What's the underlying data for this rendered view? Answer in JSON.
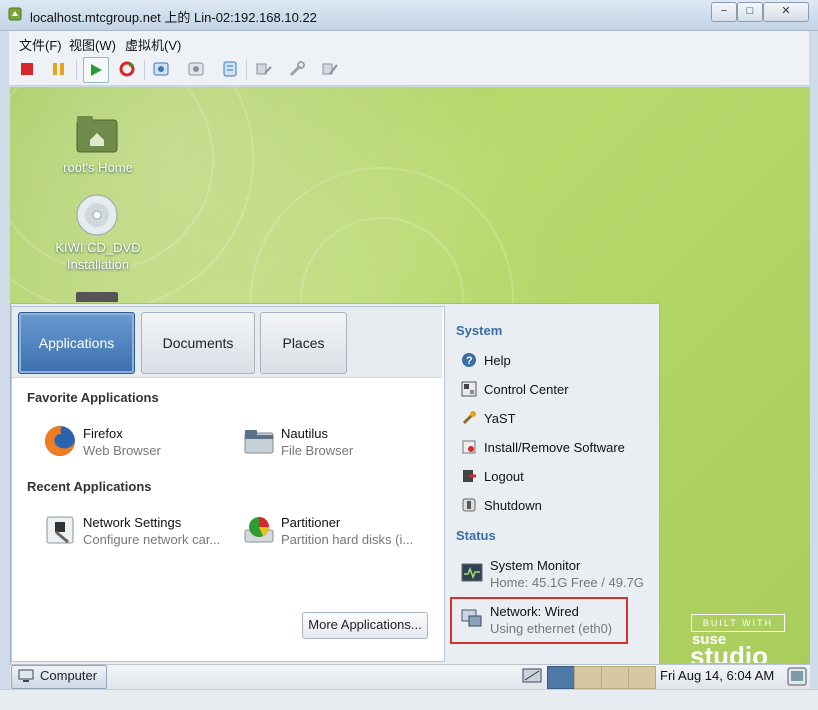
{
  "window": {
    "title": "localhost.mtcgroup.net 上的 Lin-02:192.168.10.22",
    "controls": {
      "minimize": "−",
      "maximize": "□",
      "close": "✕"
    }
  },
  "menubar": {
    "items": [
      "文件(F)",
      "视图(W)",
      "虚拟机(V)"
    ]
  },
  "desktop": {
    "icons": [
      {
        "label": "root's Home"
      },
      {
        "label_line1": "KIWI CD_DVD",
        "label_line2": "Installation"
      }
    ]
  },
  "startmenu": {
    "tabs": [
      "Applications",
      "Documents",
      "Places"
    ],
    "favorite_heading": "Favorite Applications",
    "favorites": [
      {
        "name": "Firefox",
        "desc": "Web Browser",
        "icon": "firefox-icon"
      },
      {
        "name": "Nautilus",
        "desc": "File Browser",
        "icon": "folder-icon"
      }
    ],
    "recent_heading": "Recent Applications",
    "recent": [
      {
        "name": "Network Settings",
        "desc": "Configure network car...",
        "icon": "network-settings-icon"
      },
      {
        "name": "Partitioner",
        "desc": "Partition hard disks (i...",
        "icon": "partitioner-icon"
      }
    ],
    "more_button": "More Applications...",
    "system_heading": "System",
    "system_items": [
      "Help",
      "Control Center",
      "YaST",
      "Install/Remove Software",
      "Logout",
      "Shutdown"
    ],
    "status_heading": "Status",
    "system_monitor": {
      "name": "System Monitor",
      "desc": "Home: 45.1G Free / 49.7G"
    },
    "network": {
      "name": "Network: Wired",
      "desc": "Using ethernet (eth0)"
    }
  },
  "panel": {
    "computer_button": "Computer",
    "clock": "Fri Aug 14,  6:04 AM"
  },
  "branding": {
    "built_with": "BUILT WITH",
    "suse": "suse",
    "studio": "studio"
  },
  "colors": {
    "highlight_box": "#d9302c",
    "accent": "#3a6ea5",
    "desktop_green": "#a9cd5c"
  }
}
